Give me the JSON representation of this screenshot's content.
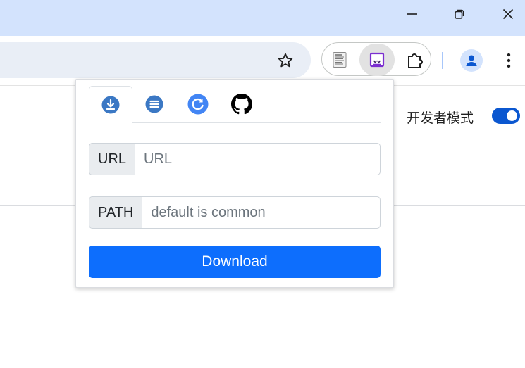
{
  "window_controls": {
    "minimize_icon": "minimize-icon",
    "restore_icon": "restore-icon",
    "close_icon": "close-icon"
  },
  "toolbar": {
    "bookmark_icon": "star-icon",
    "extensions": [
      {
        "icon": "document-extension-icon"
      },
      {
        "icon": "downloader-extension-icon",
        "active": true
      },
      {
        "icon": "puzzle-piece-icon"
      }
    ],
    "profile_icon": "account-icon",
    "menu_icon": "more-vertical-icon"
  },
  "page": {
    "developer_mode_label": "开发者模式",
    "developer_mode_enabled": true
  },
  "popup": {
    "tabs": [
      {
        "icon": "download-icon",
        "active": true
      },
      {
        "icon": "list-icon",
        "active": false
      },
      {
        "icon": "refresh-icon",
        "active": false
      },
      {
        "icon": "github-icon",
        "active": false
      }
    ],
    "url_field": {
      "label": "URL",
      "placeholder": "URL",
      "value": ""
    },
    "path_field": {
      "label": "PATH",
      "placeholder": "default is common",
      "value": ""
    },
    "download_button": "Download"
  },
  "colors": {
    "titlebar": "#d3e3fd",
    "omnibox": "#e9eef6",
    "primary_button": "#0d6efd",
    "toggle": "#0b57d0",
    "tab_icon_blue": "#3b78c4"
  }
}
